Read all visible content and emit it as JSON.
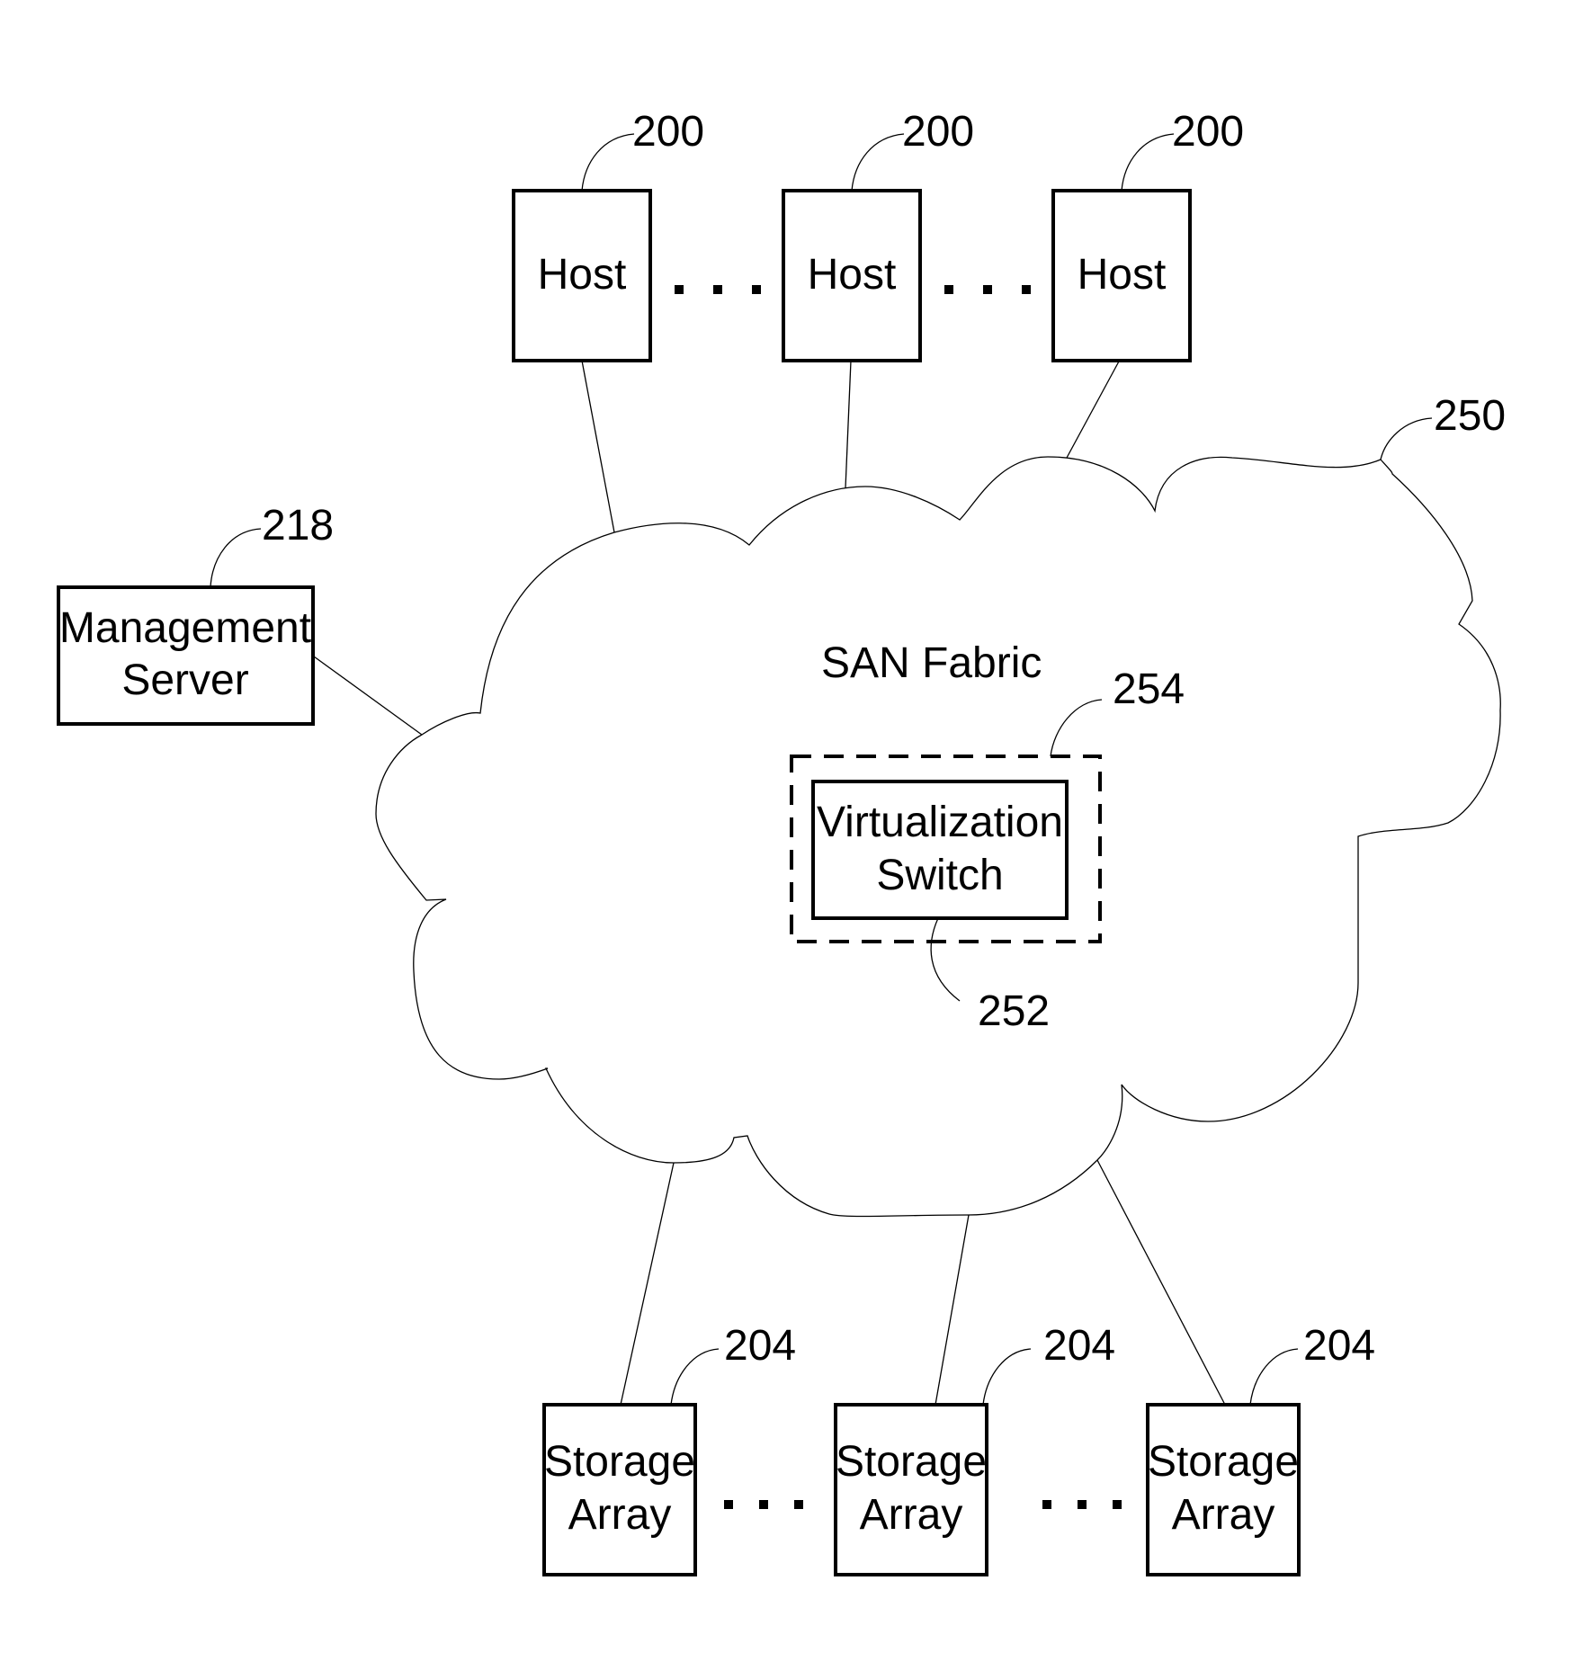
{
  "figure": {
    "cloud": {
      "label": "SAN Fabric",
      "ref": "250"
    },
    "management_server": {
      "lines": [
        "Management",
        "Server"
      ],
      "ref": "218"
    },
    "virtualization_switch": {
      "lines": [
        "Virtualization",
        "Switch"
      ],
      "ref": "252",
      "container_ref": "254"
    },
    "hosts": [
      {
        "label": "Host",
        "ref": "200"
      },
      {
        "label": "Host",
        "ref": "200"
      },
      {
        "label": "Host",
        "ref": "200"
      }
    ],
    "storage_arrays": [
      {
        "lines": [
          "Storage",
          "Array"
        ],
        "ref": "204"
      },
      {
        "lines": [
          "Storage",
          "Array"
        ],
        "ref": "204"
      },
      {
        "lines": [
          "Storage",
          "Array"
        ],
        "ref": "204"
      }
    ],
    "ellipsis": "…"
  }
}
